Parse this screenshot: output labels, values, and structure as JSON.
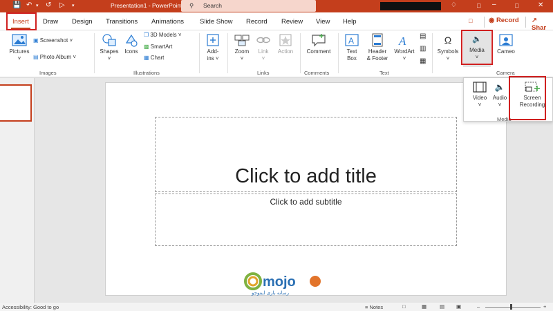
{
  "titlebar": {
    "doc_title": "Presentation1  -  PowerPoint",
    "search_placeholder": "Search",
    "colors": {
      "accent": "#c43e1c",
      "highlight": "#d02020"
    }
  },
  "tabs": [
    "Insert",
    "Draw",
    "Design",
    "Transitions",
    "Animations",
    "Slide Show",
    "Record",
    "Review",
    "View",
    "Help"
  ],
  "header_buttons": {
    "record": "Record",
    "share": "Shar"
  },
  "ribbon": {
    "images": {
      "label": "Images",
      "pictures": "Pictures",
      "screenshot": "Screenshot",
      "photo_album": "Photo Album"
    },
    "illustrations": {
      "label": "Illustrations",
      "shapes": "Shapes",
      "icons": "Icons",
      "models": "3D Models",
      "smartart": "SmartArt",
      "chart": "Chart"
    },
    "addins": {
      "line1": "Add-",
      "line2": "ins"
    },
    "links": {
      "label": "Links",
      "zoom": "Zoom",
      "link": "Link",
      "action": "Action"
    },
    "comments": {
      "label": "Comments",
      "comment": "Comment"
    },
    "text": {
      "label": "Text",
      "textbox_1": "Text",
      "textbox_2": "Box",
      "header_1": "Header",
      "header_2": "& Footer",
      "wordart": "WordArt"
    },
    "symbols": {
      "label": "Symbols"
    },
    "media": {
      "label": "Media"
    },
    "camera": {
      "label": "Camera",
      "cameo": "Cameo"
    }
  },
  "media_menu": {
    "video": "Video",
    "audio": "Audio",
    "screen_1": "Screen",
    "screen_2": "Recording",
    "group_label": "Media"
  },
  "slide": {
    "title_placeholder": "Click to add title",
    "subtitle_placeholder": "Click to add subtitle"
  },
  "statusbar": {
    "accessibility": "Accessibility: Good to go",
    "notes": "Notes"
  },
  "watermark": {
    "brand": "mojo",
    "tagline": "رسانه بازی ایموجو"
  }
}
